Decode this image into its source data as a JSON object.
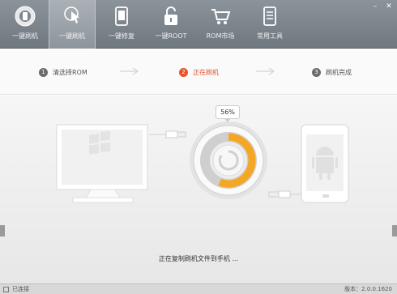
{
  "toolbar": {
    "items": [
      {
        "label": "一键刷机",
        "icon": "phone-gear-icon",
        "active": false
      },
      {
        "label": "一键刷机",
        "icon": "hand-tap-icon",
        "active": true
      },
      {
        "label": "一键修复",
        "icon": "phone-repair-icon",
        "active": false
      },
      {
        "label": "一键ROOT",
        "icon": "unlock-icon",
        "active": false
      },
      {
        "label": "ROM市场",
        "icon": "cart-icon",
        "active": false
      },
      {
        "label": "常用工具",
        "icon": "tools-icon",
        "active": false
      }
    ],
    "minimize": "–",
    "close": "✕"
  },
  "steps": [
    {
      "num": "1",
      "label": "清选择ROM",
      "state": "done"
    },
    {
      "num": "2",
      "label": "正在刷机",
      "state": "current"
    },
    {
      "num": "3",
      "label": "刷机完成",
      "state": "pending"
    }
  ],
  "progress": {
    "percent_label": "56%",
    "fraction": 0.56
  },
  "status_message": "正在复制刷机文件到手机 ...",
  "statusbar": {
    "left": "已连接",
    "right": "版本：2.0.0.1620"
  },
  "colors": {
    "accent": "#e8532c",
    "ring": "#f5a623",
    "toolbar": "#7d858d"
  }
}
